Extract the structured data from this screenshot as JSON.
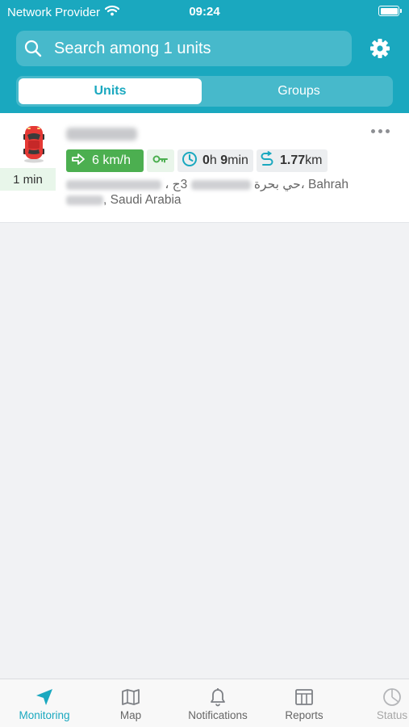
{
  "status_bar": {
    "provider": "Network Provider",
    "time": "09:24"
  },
  "search": {
    "text": "Search among 1 units"
  },
  "segments": {
    "units": "Units",
    "groups": "Groups",
    "selected": "Units"
  },
  "unit": {
    "time_ago": "1 min",
    "speed": "6 km/h",
    "duration_hours_value": "0",
    "duration_hours_unit": "h",
    "duration_minutes_value": "9",
    "duration_minutes_unit": "min",
    "distance_value": "1.77",
    "distance_unit": "km",
    "address_line1_visible": "، حي بحرة",
    "address_line1_mid": " 3ج، Bahrah",
    "address_line2_visible": ", Saudi Arabia",
    "speed_color": "#4caf50",
    "car_color": "#e53935"
  },
  "tabbar": {
    "active": "Monitoring",
    "items": [
      {
        "label": "Monitoring",
        "icon": "navigation-arrow-icon"
      },
      {
        "label": "Map",
        "icon": "map-icon"
      },
      {
        "label": "Notifications",
        "icon": "bell-icon"
      },
      {
        "label": "Reports",
        "icon": "table-icon"
      },
      {
        "label": "Status",
        "icon": "pie-chart-icon"
      }
    ]
  },
  "colors": {
    "accent": "#1aa8bf",
    "background": "#f1f2f4"
  }
}
